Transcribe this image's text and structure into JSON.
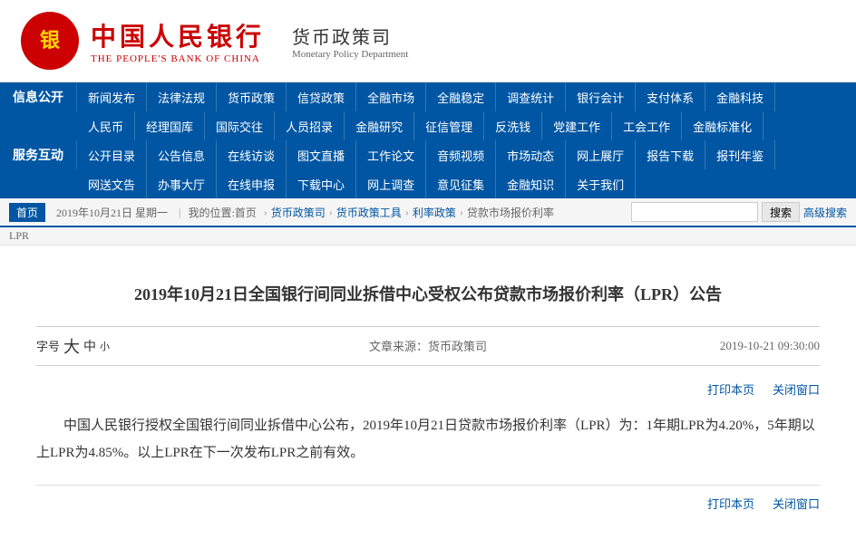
{
  "header": {
    "logo_cn": "中国人民银行",
    "logo_en": "THE PEOPLE'S BANK OF CHINA",
    "dept_cn": "货币政策司",
    "dept_en": "Monetary Policy Department"
  },
  "nav": {
    "row1_label": "信息公开",
    "row2_label": "服务互动",
    "row1_items": [
      "新闻发布",
      "法律法规",
      "货币政策",
      "信贷政策",
      "全融市场",
      "全融稳定",
      "调查统计",
      "银行会计",
      "支付体系",
      "金融科技"
    ],
    "row2_items": [
      "人民币",
      "经理国库",
      "国际交往",
      "人员招录",
      "金融研究",
      "征信管理",
      "反洗钱",
      "党建工作",
      "工会工作",
      "金融标准化"
    ],
    "row3_items": [
      "公开目录",
      "公告信息",
      "在线访谈",
      "图文直播",
      "工作论文",
      "音频视频",
      "市场动态",
      "网上展厅",
      "报告下载",
      "报刊年鉴"
    ],
    "row4_items": [
      "网送文告",
      "办事大厅",
      "在线申报",
      "下载中心",
      "网上调查",
      "意见征集",
      "金融知识",
      "关于我们"
    ]
  },
  "breadcrumb": {
    "home": "首页",
    "date": "2019年10月21日 星期一",
    "position_label": "我的位置:首页",
    "items": [
      "货币政策司",
      "货币政策工具",
      "利率政策",
      "贷款市场报价利率"
    ],
    "sub": "LPR"
  },
  "search": {
    "placeholder": "",
    "search_btn": "搜索",
    "advanced": "高级搜索"
  },
  "article": {
    "title": "2019年10月21日全国银行间同业拆借中心受权公布贷款市场报价利率（LPR）公告",
    "font_label": "字号",
    "font_large": "大",
    "font_medium": "中",
    "font_small": "小",
    "source_label": "文章来源：",
    "source": "货币政策司",
    "date": "2019-10-21 09:30:00",
    "print": "打印本页",
    "close": "关闭窗口",
    "body": "中国人民银行授权全国银行间同业拆借中心公布，2019年10月21日贷款市场报价利率（LPR）为：1年期LPR为4.20%，5年期以上LPR为4.85%。以上LPR在下一次发布LPR之前有效。",
    "print2": "打印本页",
    "close2": "关闭窗口"
  }
}
